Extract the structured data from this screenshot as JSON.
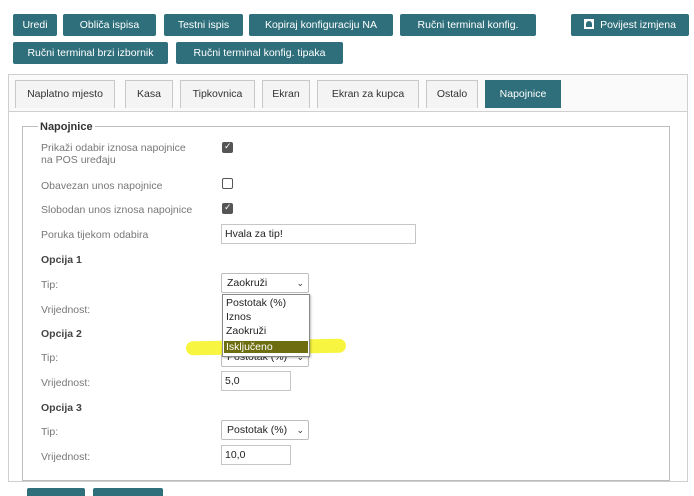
{
  "toolbar": {
    "row1": [
      "Uredi",
      "Obliča ispisa",
      "Testni ispis",
      "Kopiraj konfiguraciju NA",
      "Ručni terminal konfig.",
      "Povijest izmjena"
    ],
    "row2": [
      "Ručni terminal brzi izbornik",
      "Ručni terminal konfig. tipaka"
    ]
  },
  "tabs": [
    "Naplatno mjesto",
    "Kasa",
    "Tipkovnica",
    "Ekran",
    "Ekran za kupca",
    "Ostalo",
    "Napojnice"
  ],
  "active_tab": "Napojnice",
  "form": {
    "legend": "Napojnice",
    "show_tip_label_line1": "Prikaži odabir iznosa napojnice",
    "show_tip_label_line2": "na POS uređaju",
    "show_tip_checked": true,
    "mandatory_label": "Obavezan unos napojnice",
    "mandatory_checked": false,
    "free_entry_label": "Slobodan unos iznosa napojnice",
    "free_entry_checked": true,
    "message_label": "Poruka tijekom odabira",
    "message_value": "Hvala za tip!",
    "option1": {
      "title": "Opcija 1",
      "type_label": "Tip:",
      "type_value": "Zaokruži",
      "value_label": "Vrijednost:"
    },
    "option2": {
      "title": "Opcija 2",
      "type_label": "Tip:",
      "type_value": "Postotak (%)",
      "value_label": "Vrijednost:",
      "value": "5,0"
    },
    "option3": {
      "title": "Opcija 3",
      "type_label": "Tip:",
      "type_value": "Postotak (%)",
      "value_label": "Vrijednost:",
      "value": "10,0"
    }
  },
  "dropdown_options": [
    "Postotak (%)",
    "Iznos",
    "Zaokruži",
    "Isključeno"
  ],
  "dropdown_highlighted": "Isključeno",
  "colors": {
    "accent": "#2f6f7b",
    "highlight_marker": "#f5f200"
  }
}
